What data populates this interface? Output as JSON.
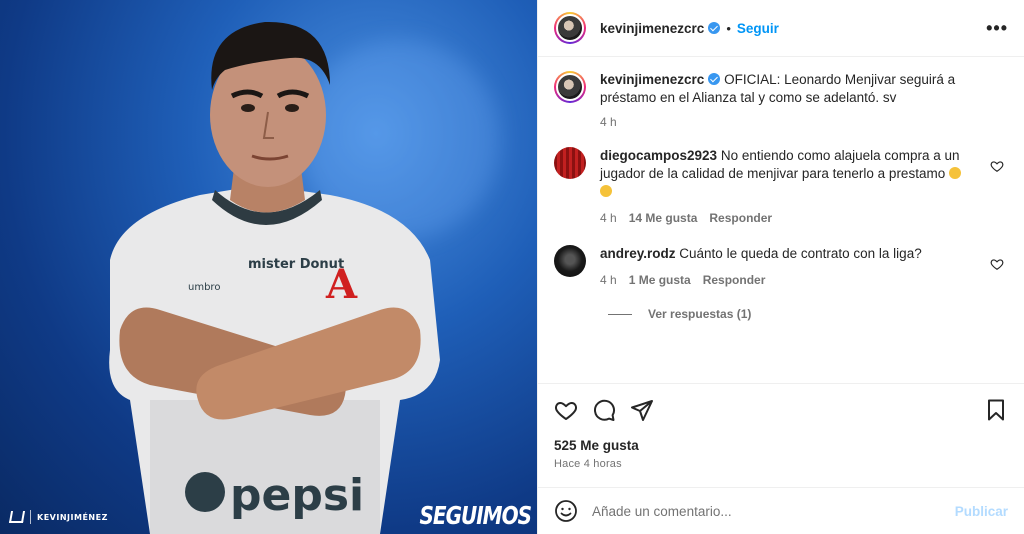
{
  "image": {
    "brand_name": "KEVINJIMÉNEZ",
    "slogan": "SEGUIMOS",
    "jersey_sponsor": "pepsi",
    "jersey_partner": "mister Donut",
    "jersey_maker": "umbro",
    "jersey_crest": "A"
  },
  "header": {
    "username": "kevinjimenezcrc",
    "dot": "•",
    "follow_label": "Seguir",
    "more_label": "•••"
  },
  "caption": {
    "username": "kevinjimenezcrc",
    "text": "OFICIAL: Leonardo Menjivar seguirá a préstamo en el Alianza tal y como se adelantó. sv",
    "time": "4 h"
  },
  "comments": [
    {
      "username": "diegocampos2923",
      "text": "No entiendo como alajuela compra a un jugador de la calidad de menjivar para tenerlo a prestamo",
      "time": "4 h",
      "likes": "14 Me gusta",
      "reply_label": "Responder"
    },
    {
      "username": "andrey.rodz",
      "text": "Cuánto le queda de contrato con la liga?",
      "time": "4 h",
      "likes": "1 Me gusta",
      "reply_label": "Responder",
      "view_replies": "Ver respuestas (1)"
    }
  ],
  "actions": {
    "like_count": "525 Me gusta",
    "posted_ago": "Hace 4 horas"
  },
  "composer": {
    "placeholder": "Añade un comentario...",
    "post_label": "Publicar"
  },
  "colors": {
    "accent": "#0095f6",
    "verified": "#3897f0",
    "muted": "#737373",
    "post_disabled": "#b3dbff"
  }
}
